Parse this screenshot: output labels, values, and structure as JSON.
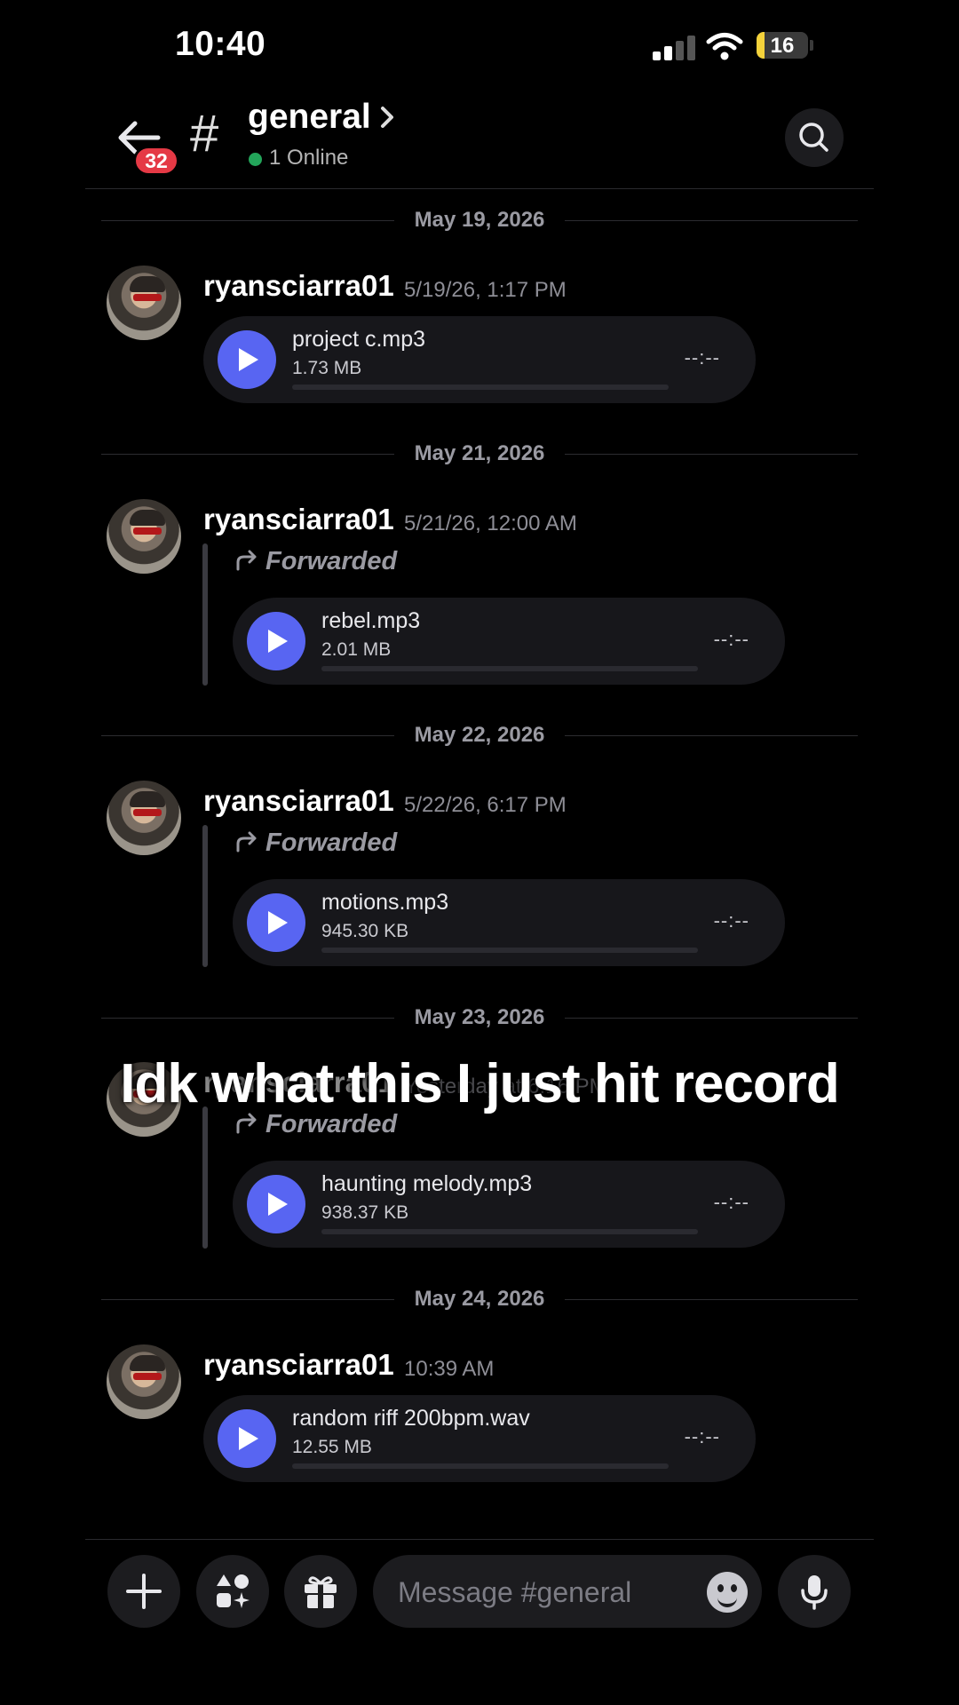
{
  "status_bar": {
    "time": "10:40",
    "battery": "16"
  },
  "header": {
    "unread_badge": "32",
    "channel": "general",
    "online": "1 Online"
  },
  "dates": [
    "May 19, 2026",
    "May 21, 2026",
    "May 22, 2026",
    "May 23, 2026",
    "May 24, 2026"
  ],
  "messages": [
    {
      "user": "ryansciarra01",
      "time": "5/19/26, 1:17 PM",
      "file": "project c.mp3",
      "size": "1.73 MB",
      "duration": "--:--"
    },
    {
      "user": "ryansciarra01",
      "time": "5/21/26, 12:00 AM",
      "forwarded": "Forwarded",
      "file": "rebel.mp3",
      "size": "2.01 MB",
      "duration": "--:--"
    },
    {
      "user": "ryansciarra01",
      "time": "5/22/26, 6:17 PM",
      "forwarded": "Forwarded",
      "file": "motions.mp3",
      "size": "945.30 KB",
      "duration": "--:--"
    },
    {
      "user": "ryansciarra01",
      "time": "Yesterday at 6:16 PM",
      "forwarded": "Forwarded",
      "file": "haunting melody.mp3",
      "size": "938.37 KB",
      "duration": "--:--"
    },
    {
      "user": "ryansciarra01",
      "time": "10:39 AM",
      "file": "random riff 200bpm.wav",
      "size": "12.55 MB",
      "duration": "--:--"
    }
  ],
  "caption": "Idk what this I just hit record",
  "composer": {
    "placeholder": "Message #general"
  },
  "colors": {
    "accent": "#5865f2",
    "badge": "#e53945",
    "online": "#23a55a",
    "battery": "#f4d23b"
  },
  "icons": [
    "back-arrow-icon",
    "hash-icon",
    "chevron-right-icon",
    "search-icon",
    "forward-icon",
    "play-icon",
    "plus-icon",
    "apps-icon",
    "gift-icon",
    "emoji-icon",
    "microphone-icon"
  ]
}
